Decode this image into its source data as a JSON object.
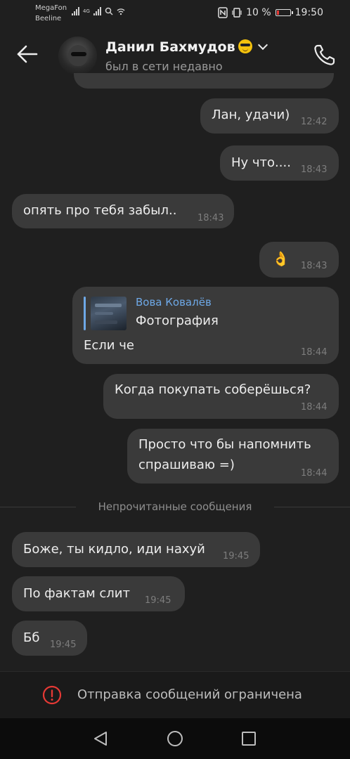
{
  "status_bar": {
    "carrier1": "MegaFon",
    "carrier2": "Beeline",
    "network_label": "4G",
    "battery": "10 %",
    "time": "19:50"
  },
  "header": {
    "name": "Данил Бахмудов",
    "status": "был в сети недавно",
    "name_emoji": "smiling-face-with-sunglasses"
  },
  "messages": [
    {
      "text": "Лан, удачи)",
      "time": "12:42",
      "side": "out"
    },
    {
      "text": "Ну что....",
      "time": "18:43",
      "side": "out"
    },
    {
      "text": "опять про тебя забыл..",
      "time": "18:43",
      "side": "in"
    },
    {
      "text": "👌",
      "time": "18:43",
      "side": "out"
    },
    {
      "reply_author": "Вова Ковалёв",
      "reply_text": "Фотография",
      "text": "Если че",
      "time": "18:44",
      "side": "out"
    },
    {
      "text": "Когда покупать соберёшься?",
      "time": "18:44",
      "side": "out"
    },
    {
      "text_line1": "Просто что бы напомнить",
      "text_line2": "спрашиваю =)",
      "time": "18:44",
      "side": "out"
    },
    {
      "text": "Боже, ты кидло, иди нахуй",
      "time": "19:45",
      "side": "in"
    },
    {
      "text": "По фактам слит",
      "time": "19:45",
      "side": "in"
    },
    {
      "text": "Бб",
      "time": "19:45",
      "side": "in"
    }
  ],
  "unread_divider": "Непрочитанные сообщения",
  "footer": {
    "notice": "Отправка сообщений ограничена"
  },
  "colors": {
    "background": "#1f1f1f",
    "bubble": "#3a3a3a",
    "reply_accent": "#6ea8e6",
    "warning": "#e53935"
  }
}
